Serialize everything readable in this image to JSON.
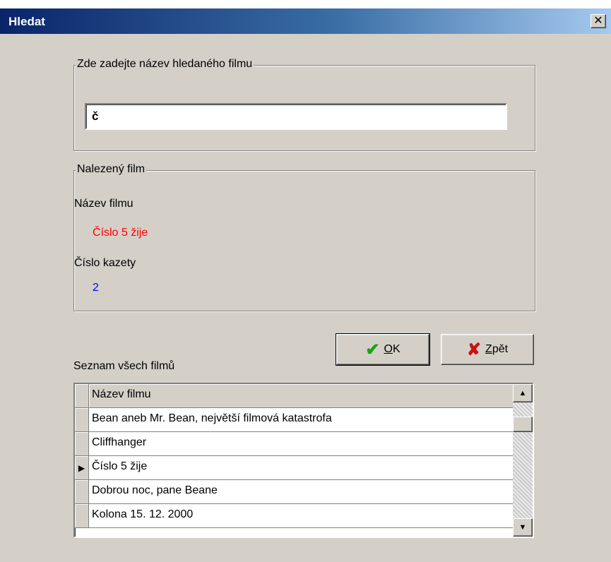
{
  "window": {
    "title": "Hledat",
    "close_glyph": "✕"
  },
  "search": {
    "group_label": "Zde zadejte název hledaného filmu",
    "value": "č"
  },
  "found": {
    "group_label": "Nalezený film",
    "title_label": "Název filmu",
    "title_value": "Číslo 5 žije",
    "cassette_label": "Číslo kazety",
    "cassette_value": "2"
  },
  "buttons": {
    "ok_underlined": "O",
    "ok_rest": "K",
    "back_underlined": "Z",
    "back_rest": "pět"
  },
  "list": {
    "label": "Seznam všech filmů",
    "column_header": "Název filmu",
    "rows": [
      "Bean aneb Mr. Bean, největší filmová katastrofa",
      "Cliffhanger",
      "Číslo 5 žije",
      "Dobrou noc, pane Beane",
      "Kolona 15. 12. 2000"
    ],
    "selected_index": 2
  },
  "icons": {
    "ok": "check-icon",
    "back": "cross-icon",
    "current_row": "row-pointer-icon",
    "scroll_up": "scroll-up-icon",
    "scroll_down": "scroll-down-icon"
  },
  "colors": {
    "found_title": "#ff0000",
    "found_cassette": "#0000ff",
    "titlebar_start": "#0a246a",
    "titlebar_end": "#a6caf0"
  }
}
